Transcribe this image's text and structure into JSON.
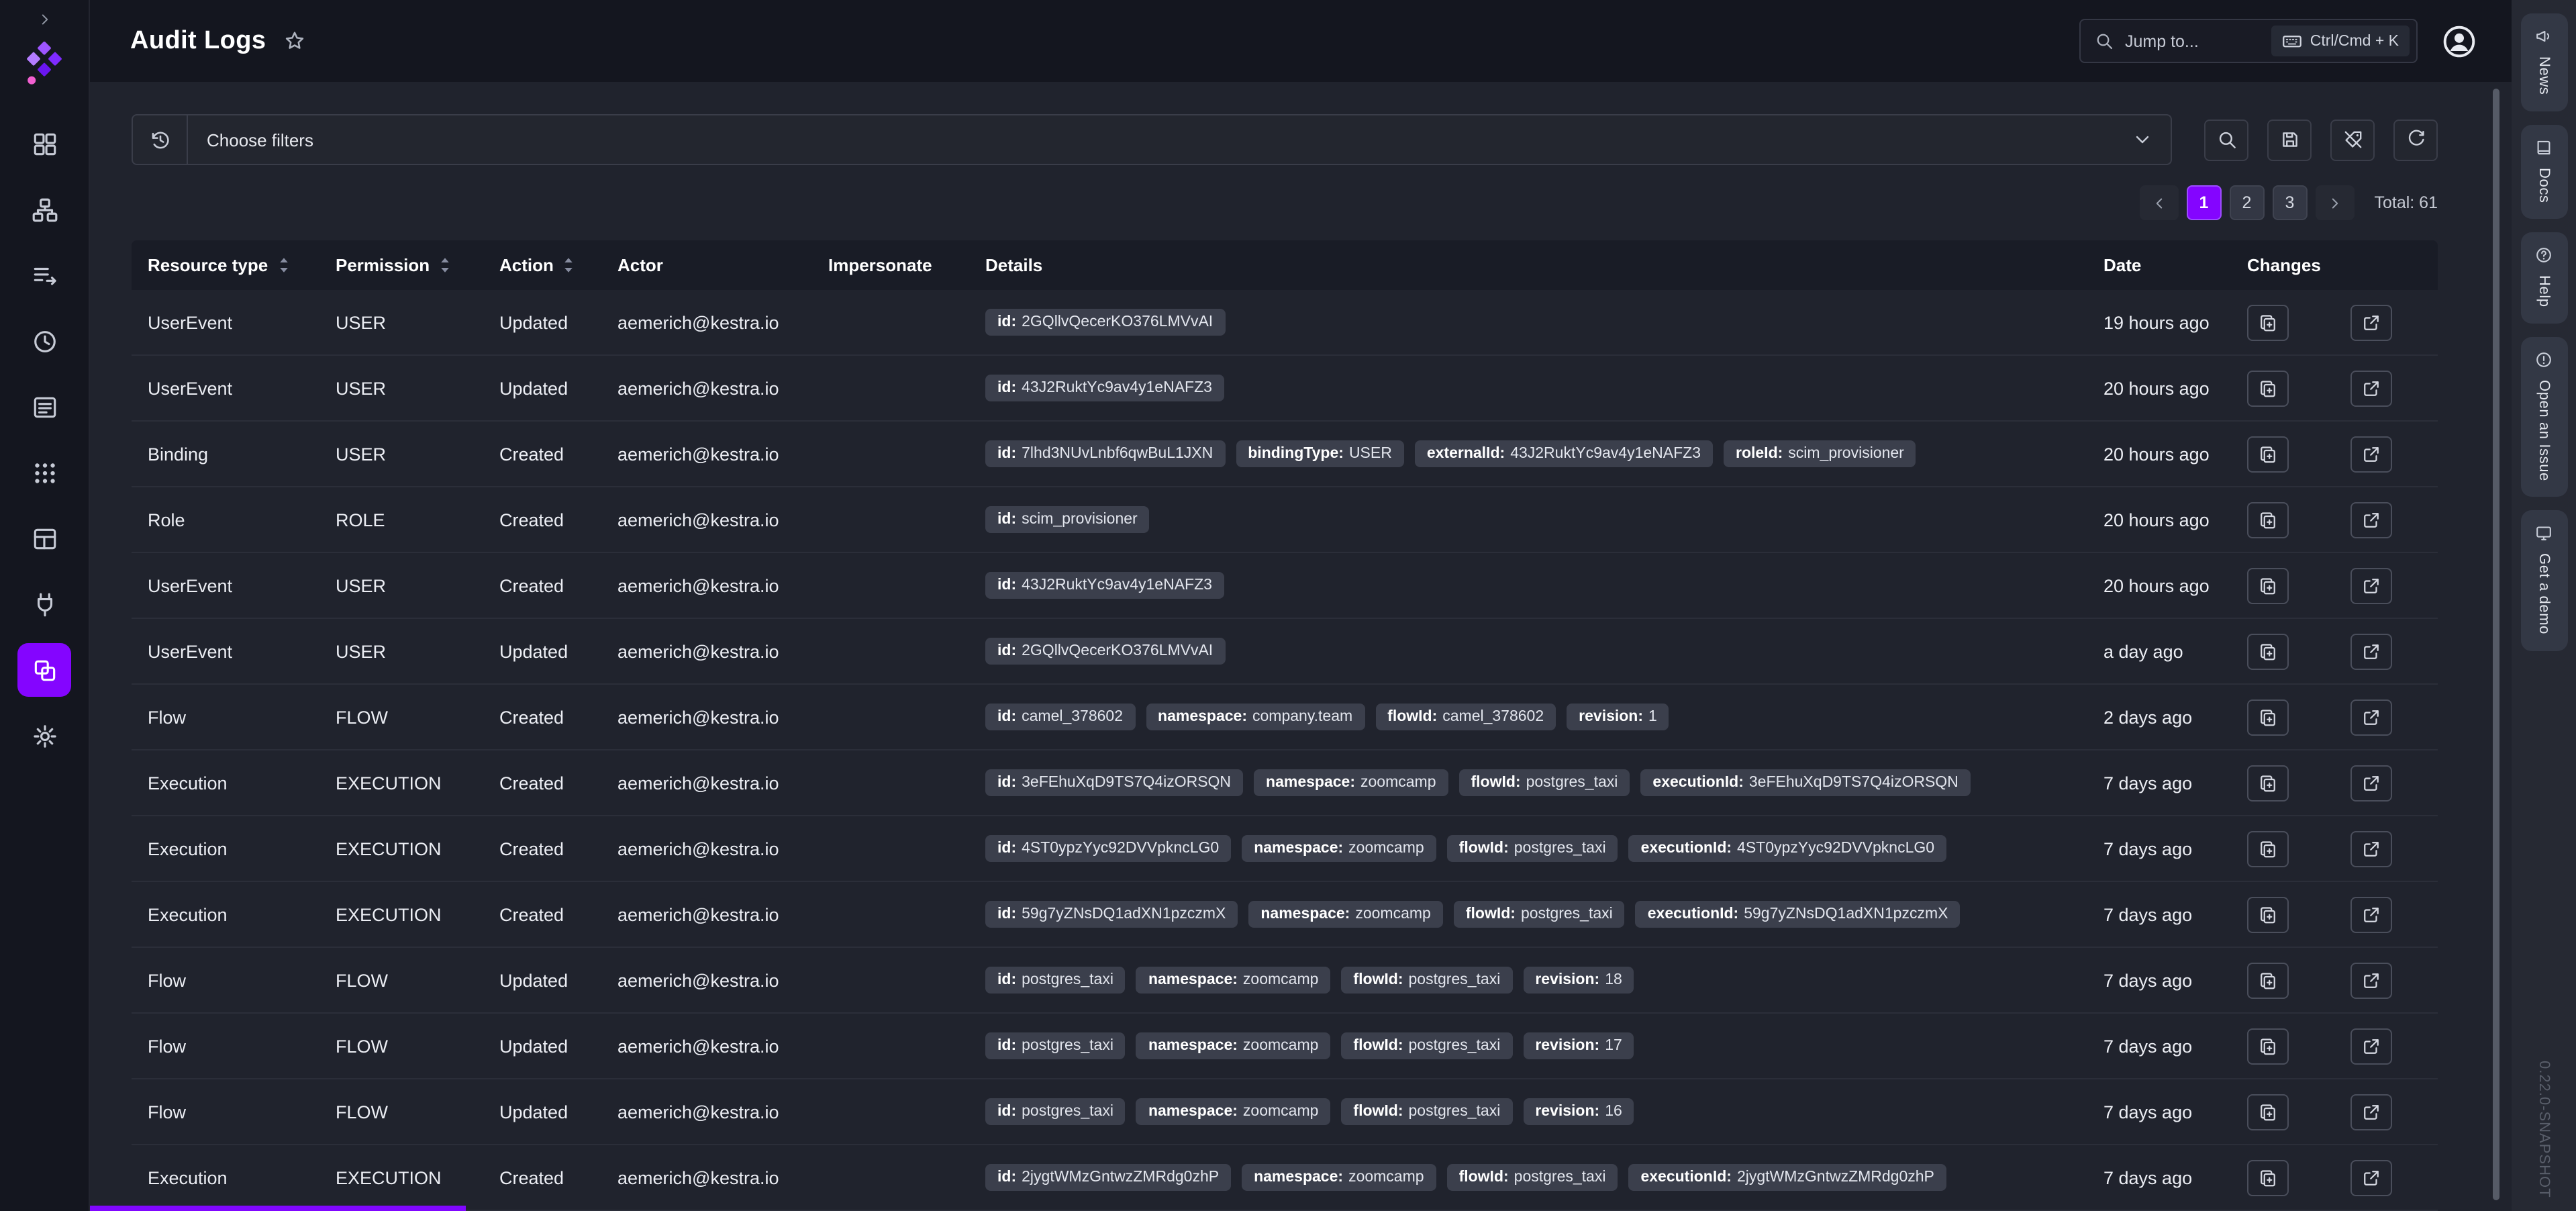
{
  "header": {
    "title": "Audit Logs",
    "search_placeholder": "Jump to...",
    "shortcut": "Ctrl/Cmd + K"
  },
  "filter": {
    "placeholder": "Choose filters"
  },
  "pagination": {
    "pages": [
      "1",
      "2",
      "3"
    ],
    "active": "1",
    "total_label": "Total: 61"
  },
  "sidebar": {
    "items": [
      {
        "id": "dashboard",
        "icon": "dashboard-icon"
      },
      {
        "id": "namespaces",
        "icon": "namespaces-icon"
      },
      {
        "id": "flows",
        "icon": "flows-icon"
      },
      {
        "id": "executions",
        "icon": "executions-icon"
      },
      {
        "id": "logs",
        "icon": "logs-icon"
      },
      {
        "id": "apps",
        "icon": "apps-icon"
      },
      {
        "id": "blueprints",
        "icon": "blueprints-icon"
      },
      {
        "id": "plugins",
        "icon": "plugins-icon"
      },
      {
        "id": "administration",
        "icon": "administration-icon",
        "active": true
      },
      {
        "id": "settings",
        "icon": "settings-icon"
      }
    ]
  },
  "table": {
    "columns": [
      {
        "label": "Resource type",
        "sortable": true
      },
      {
        "label": "Permission",
        "sortable": true
      },
      {
        "label": "Action",
        "sortable": true
      },
      {
        "label": "Actor",
        "sortable": false
      },
      {
        "label": "Impersonate",
        "sortable": false
      },
      {
        "label": "Details",
        "sortable": false
      },
      {
        "label": "Date",
        "sortable": false
      },
      {
        "label": "Changes",
        "sortable": false
      }
    ],
    "rows": [
      {
        "resource_type": "UserEvent",
        "permission": "USER",
        "action": "Updated",
        "actor": "aemerich@kestra.io",
        "impersonate": "",
        "details": [
          {
            "key": "id",
            "value": "2GQllvQecerKO376LMVvAI"
          }
        ],
        "date": "19 hours ago"
      },
      {
        "resource_type": "UserEvent",
        "permission": "USER",
        "action": "Updated",
        "actor": "aemerich@kestra.io",
        "impersonate": "",
        "details": [
          {
            "key": "id",
            "value": "43J2RuktYc9av4y1eNAFZ3"
          }
        ],
        "date": "20 hours ago"
      },
      {
        "resource_type": "Binding",
        "permission": "USER",
        "action": "Created",
        "actor": "aemerich@kestra.io",
        "impersonate": "",
        "details": [
          {
            "key": "id",
            "value": "7lhd3NUvLnbf6qwBuL1JXN"
          },
          {
            "key": "bindingType",
            "value": "USER"
          },
          {
            "key": "externalId",
            "value": "43J2RuktYc9av4y1eNAFZ3"
          },
          {
            "key": "roleId",
            "value": "scim_provisioner"
          }
        ],
        "date": "20 hours ago"
      },
      {
        "resource_type": "Role",
        "permission": "ROLE",
        "action": "Created",
        "actor": "aemerich@kestra.io",
        "impersonate": "",
        "details": [
          {
            "key": "id",
            "value": "scim_provisioner"
          }
        ],
        "date": "20 hours ago"
      },
      {
        "resource_type": "UserEvent",
        "permission": "USER",
        "action": "Created",
        "actor": "aemerich@kestra.io",
        "impersonate": "",
        "details": [
          {
            "key": "id",
            "value": "43J2RuktYc9av4y1eNAFZ3"
          }
        ],
        "date": "20 hours ago"
      },
      {
        "resource_type": "UserEvent",
        "permission": "USER",
        "action": "Updated",
        "actor": "aemerich@kestra.io",
        "impersonate": "",
        "details": [
          {
            "key": "id",
            "value": "2GQllvQecerKO376LMVvAI"
          }
        ],
        "date": "a day ago"
      },
      {
        "resource_type": "Flow",
        "permission": "FLOW",
        "action": "Created",
        "actor": "aemerich@kestra.io",
        "impersonate": "",
        "details": [
          {
            "key": "id",
            "value": "camel_378602"
          },
          {
            "key": "namespace",
            "value": "company.team"
          },
          {
            "key": "flowId",
            "value": "camel_378602"
          },
          {
            "key": "revision",
            "value": "1"
          }
        ],
        "date": "2 days ago"
      },
      {
        "resource_type": "Execution",
        "permission": "EXECUTION",
        "action": "Created",
        "actor": "aemerich@kestra.io",
        "impersonate": "",
        "details": [
          {
            "key": "id",
            "value": "3eFEhuXqD9TS7Q4izORSQN"
          },
          {
            "key": "namespace",
            "value": "zoomcamp"
          },
          {
            "key": "flowId",
            "value": "postgres_taxi"
          },
          {
            "key": "executionId",
            "value": "3eFEhuXqD9TS7Q4izORSQN"
          }
        ],
        "date": "7 days ago"
      },
      {
        "resource_type": "Execution",
        "permission": "EXECUTION",
        "action": "Created",
        "actor": "aemerich@kestra.io",
        "impersonate": "",
        "details": [
          {
            "key": "id",
            "value": "4ST0ypzYyc92DVVpkncLG0"
          },
          {
            "key": "namespace",
            "value": "zoomcamp"
          },
          {
            "key": "flowId",
            "value": "postgres_taxi"
          },
          {
            "key": "executionId",
            "value": "4ST0ypzYyc92DVVpkncLG0"
          }
        ],
        "date": "7 days ago"
      },
      {
        "resource_type": "Execution",
        "permission": "EXECUTION",
        "action": "Created",
        "actor": "aemerich@kestra.io",
        "impersonate": "",
        "details": [
          {
            "key": "id",
            "value": "59g7yZNsDQ1adXN1pzczmX"
          },
          {
            "key": "namespace",
            "value": "zoomcamp"
          },
          {
            "key": "flowId",
            "value": "postgres_taxi"
          },
          {
            "key": "executionId",
            "value": "59g7yZNsDQ1adXN1pzczmX"
          }
        ],
        "date": "7 days ago"
      },
      {
        "resource_type": "Flow",
        "permission": "FLOW",
        "action": "Updated",
        "actor": "aemerich@kestra.io",
        "impersonate": "",
        "details": [
          {
            "key": "id",
            "value": "postgres_taxi"
          },
          {
            "key": "namespace",
            "value": "zoomcamp"
          },
          {
            "key": "flowId",
            "value": "postgres_taxi"
          },
          {
            "key": "revision",
            "value": "18"
          }
        ],
        "date": "7 days ago"
      },
      {
        "resource_type": "Flow",
        "permission": "FLOW",
        "action": "Updated",
        "actor": "aemerich@kestra.io",
        "impersonate": "",
        "details": [
          {
            "key": "id",
            "value": "postgres_taxi"
          },
          {
            "key": "namespace",
            "value": "zoomcamp"
          },
          {
            "key": "flowId",
            "value": "postgres_taxi"
          },
          {
            "key": "revision",
            "value": "17"
          }
        ],
        "date": "7 days ago"
      },
      {
        "resource_type": "Flow",
        "permission": "FLOW",
        "action": "Updated",
        "actor": "aemerich@kestra.io",
        "impersonate": "",
        "details": [
          {
            "key": "id",
            "value": "postgres_taxi"
          },
          {
            "key": "namespace",
            "value": "zoomcamp"
          },
          {
            "key": "flowId",
            "value": "postgres_taxi"
          },
          {
            "key": "revision",
            "value": "16"
          }
        ],
        "date": "7 days ago"
      },
      {
        "resource_type": "Execution",
        "permission": "EXECUTION",
        "action": "Created",
        "actor": "aemerich@kestra.io",
        "impersonate": "",
        "details": [
          {
            "key": "id",
            "value": "2jygtWMzGntwzZMRdg0zhP"
          },
          {
            "key": "namespace",
            "value": "zoomcamp"
          },
          {
            "key": "flowId",
            "value": "postgres_taxi"
          },
          {
            "key": "executionId",
            "value": "2jygtWMzGntwzZMRdg0zhP"
          }
        ],
        "date": "7 days ago"
      }
    ]
  },
  "dock": {
    "items": [
      {
        "id": "news",
        "label": "News",
        "icon": "news-icon"
      },
      {
        "id": "docs",
        "label": "Docs",
        "icon": "docs-icon"
      },
      {
        "id": "help",
        "label": "Help",
        "icon": "help-icon"
      },
      {
        "id": "open-an-issue",
        "label": "Open an Issue",
        "icon": "issue-icon"
      },
      {
        "id": "get-a-demo",
        "label": "Get a demo",
        "icon": "demo-icon"
      }
    ],
    "version": "0.22.0-SNAPSHOT"
  }
}
